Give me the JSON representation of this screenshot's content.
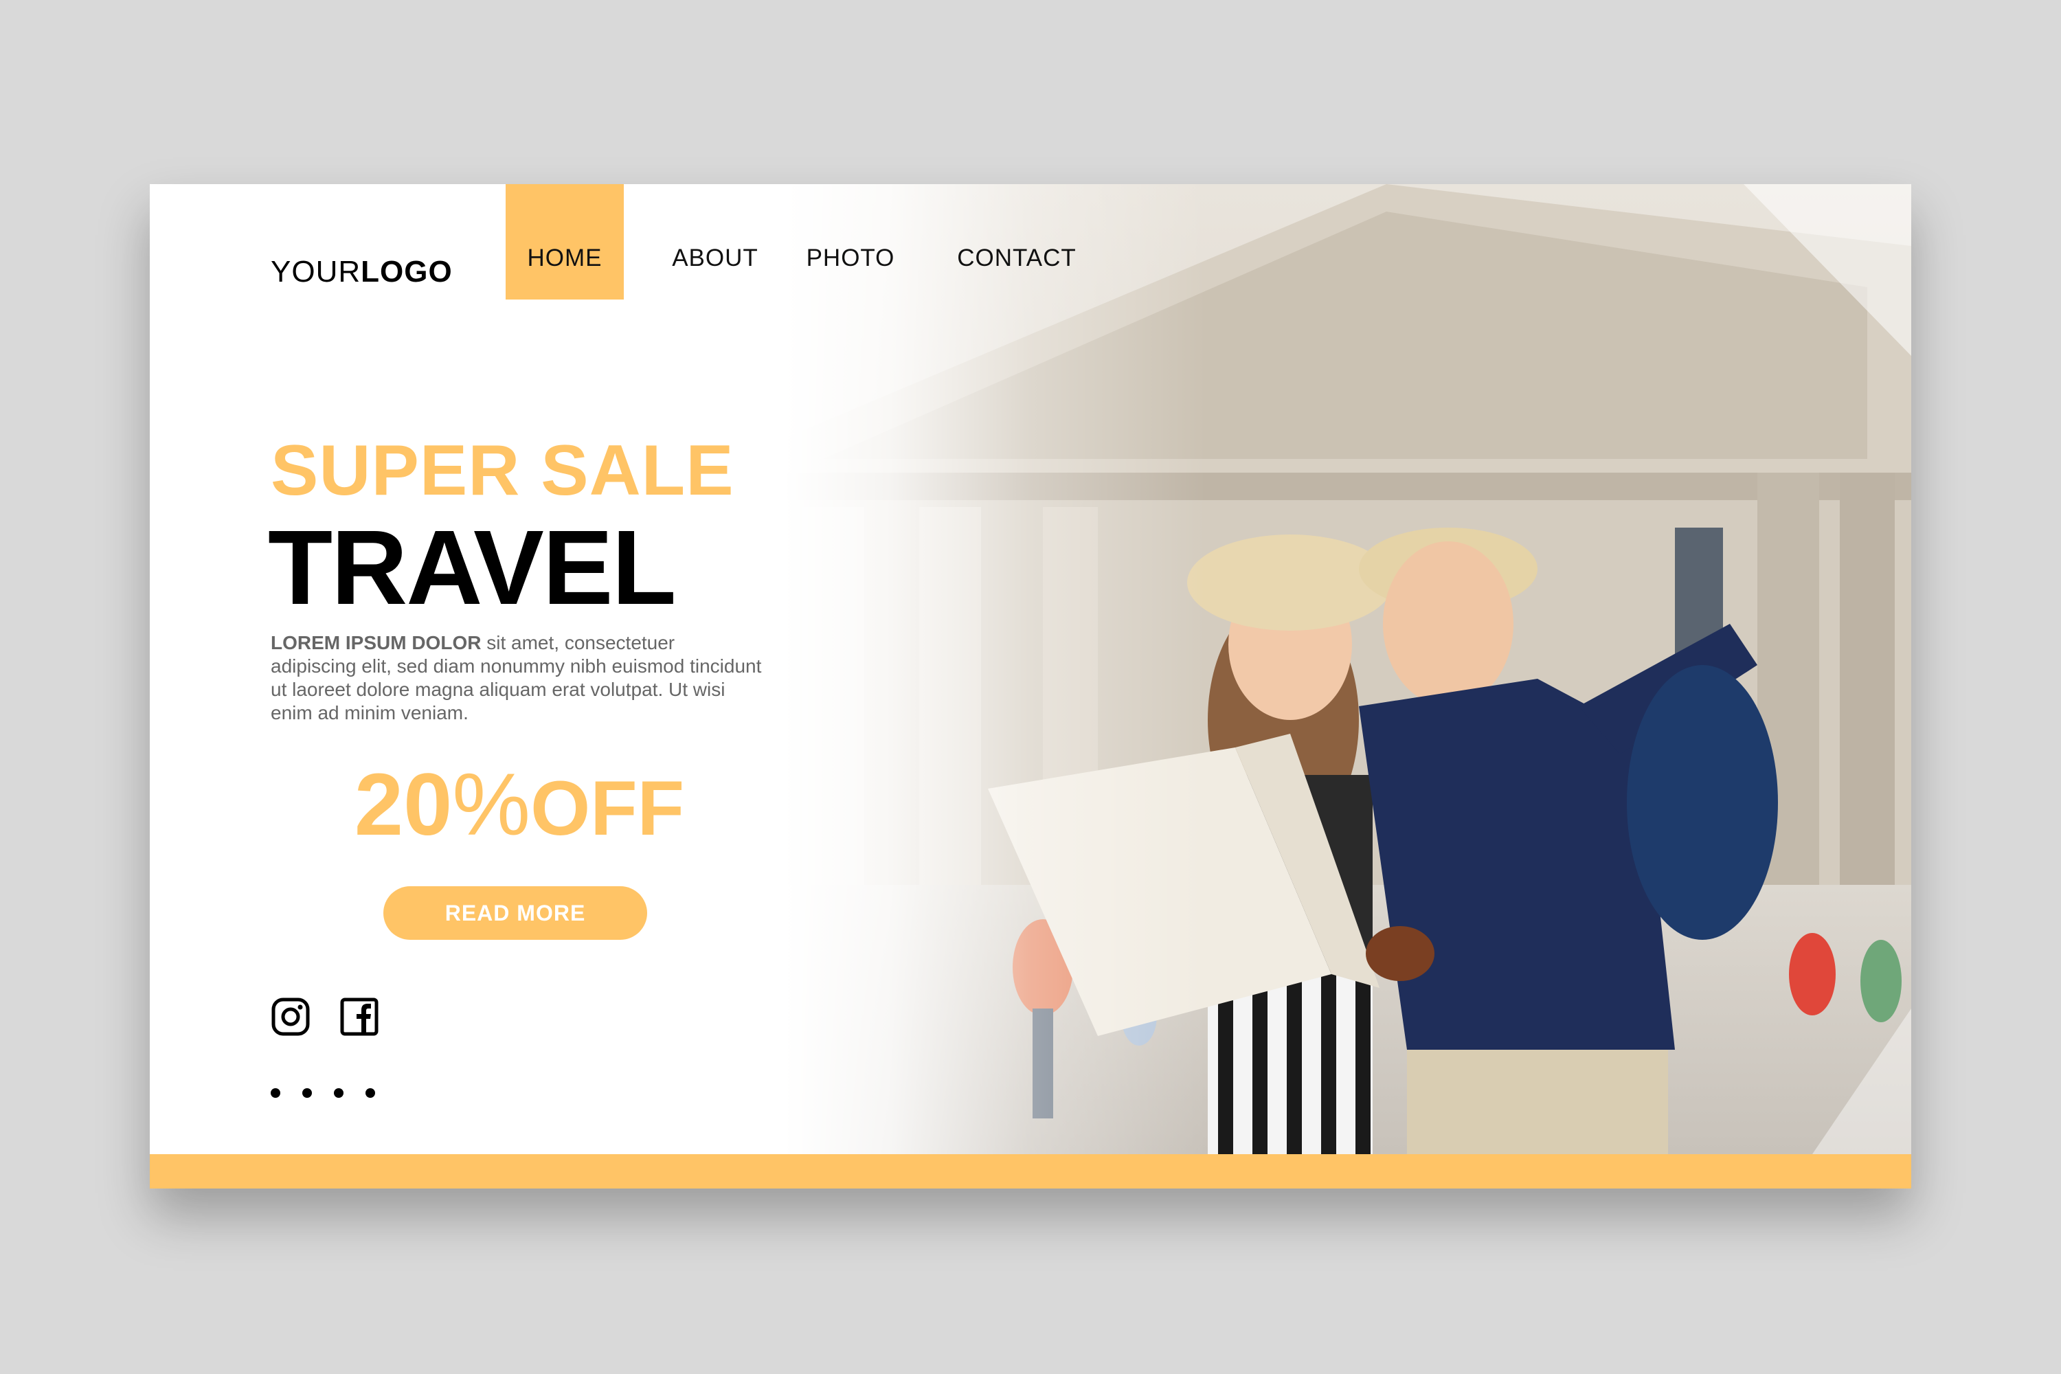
{
  "logo": {
    "prefix": "YOUR",
    "bold": "LOGO"
  },
  "nav": {
    "items": [
      {
        "label": "HOME",
        "active": true
      },
      {
        "label": "ABOUT",
        "active": false
      },
      {
        "label": "PHOTO",
        "active": false
      },
      {
        "label": "CONTACT",
        "active": false
      }
    ]
  },
  "hero": {
    "headline_top": "SUPER SALE",
    "headline_main": "TRAVEL",
    "body_bold": "LOREM IPSUM DOLOR",
    "body_rest": " sit amet, consectetuer adipiscing elit, sed diam nonummy nibh euismod tincidunt ut laoreet dolore magna aliquam erat volutpat. Ut wisi enim ad minim veniam.",
    "discount_number": "20",
    "discount_percent": "%",
    "discount_off": "OFF",
    "cta_label": "READ MORE"
  },
  "social": {
    "icons": [
      "instagram-icon",
      "facebook-icon"
    ]
  },
  "pagination": {
    "count": 4
  },
  "colors": {
    "accent": "#ffc466",
    "text": "#000000",
    "muted": "#666666",
    "background": "#d9d9d9"
  }
}
